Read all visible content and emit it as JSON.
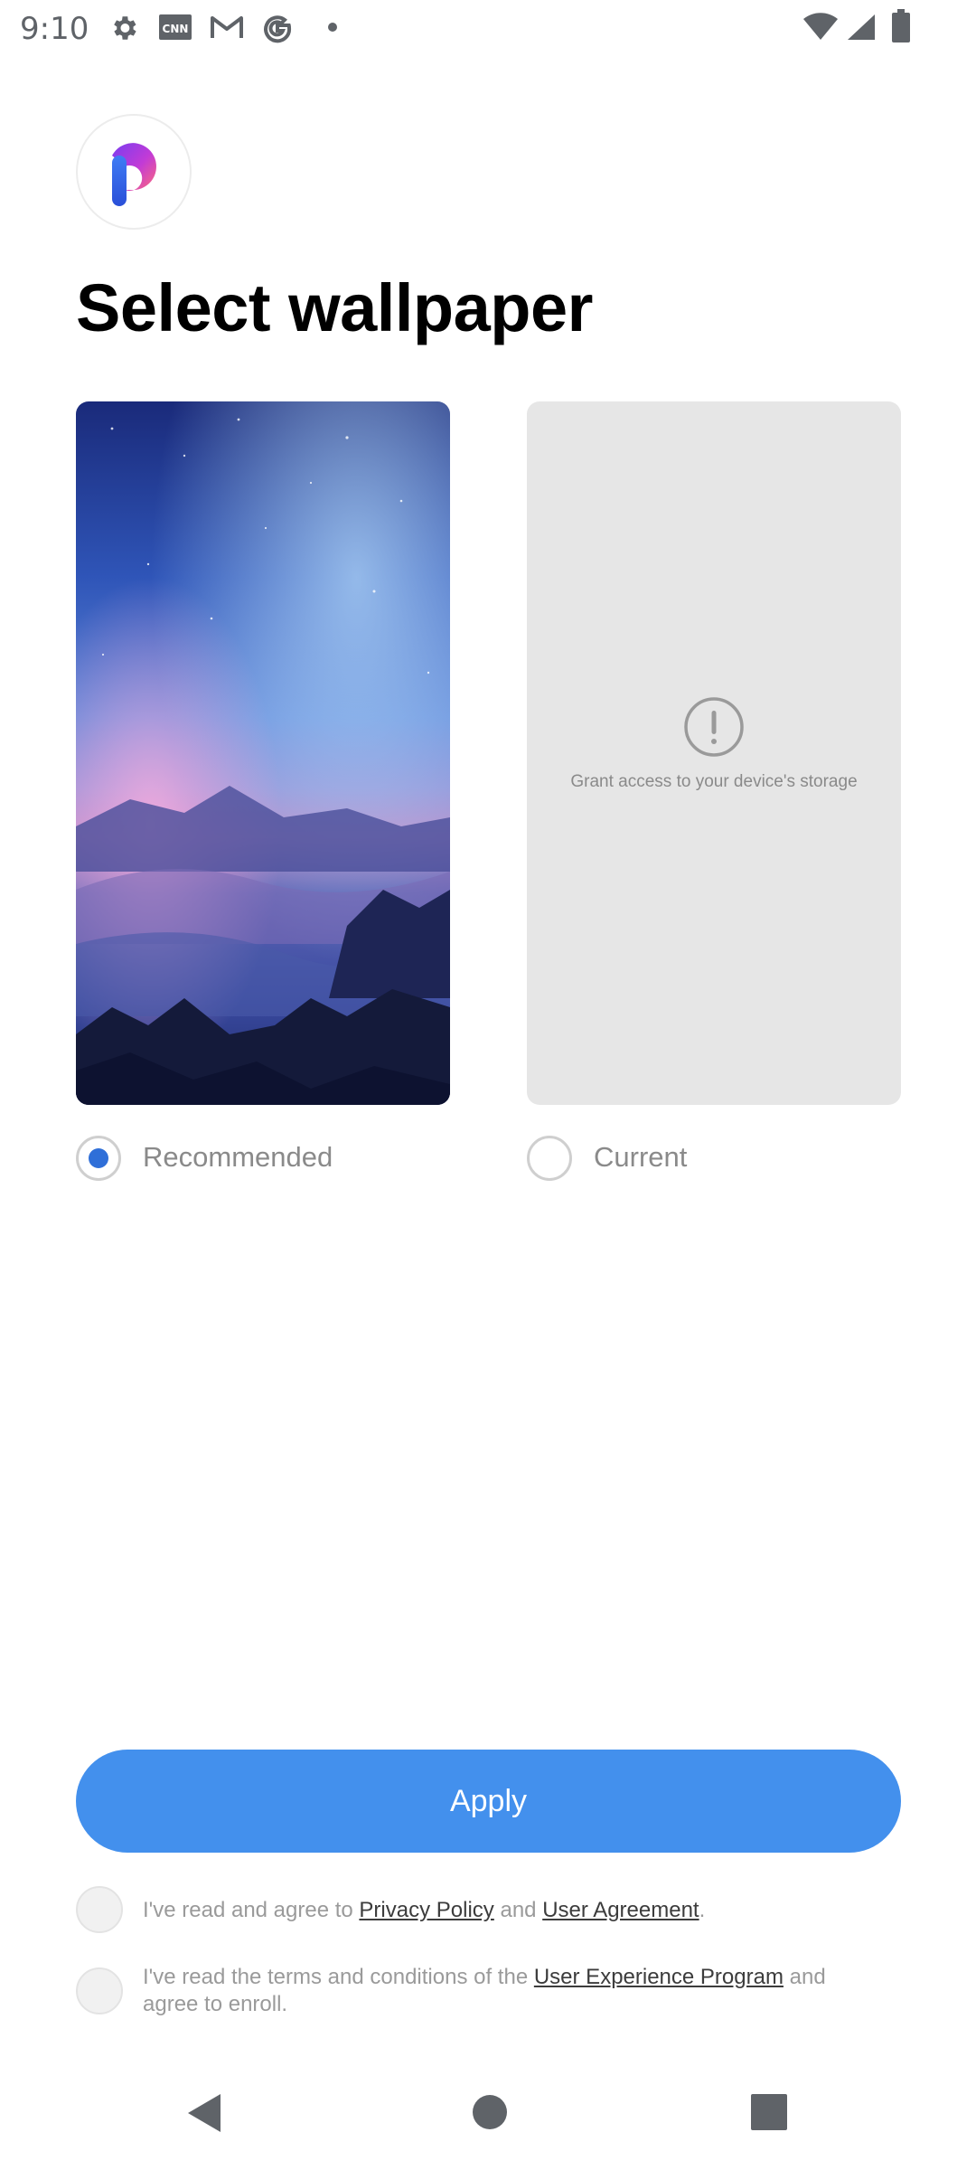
{
  "status_bar": {
    "time": "9:10",
    "icons": [
      "gear-icon",
      "cnn-icon",
      "gmail-icon",
      "google-icon",
      "dot-icon",
      "wifi-icon",
      "signal-icon",
      "battery-icon"
    ]
  },
  "logo": {
    "name": "p-logo"
  },
  "title": "Select wallpaper",
  "wallpapers": {
    "recommended": {
      "label": "Recommended",
      "selected": true
    },
    "current": {
      "label": "Current",
      "selected": false,
      "message": "Grant access to your device's storage"
    }
  },
  "apply": {
    "label": "Apply"
  },
  "agreements": {
    "privacy": {
      "prefix": "I've read and agree to ",
      "link1": "Privacy Policy",
      "middle": " and ",
      "link2": "User Agreement",
      "suffix": "."
    },
    "experience": {
      "prefix": "I've read the terms and conditions of the ",
      "link": "User Experience Program",
      "suffix": " and agree to enroll."
    }
  },
  "colors": {
    "accent": "#4390ed",
    "radio_selected": "#2f6fd8",
    "text_muted": "#8a8a8a"
  },
  "nav": {
    "back": "back-icon",
    "home": "home-icon",
    "recents": "recents-icon"
  }
}
